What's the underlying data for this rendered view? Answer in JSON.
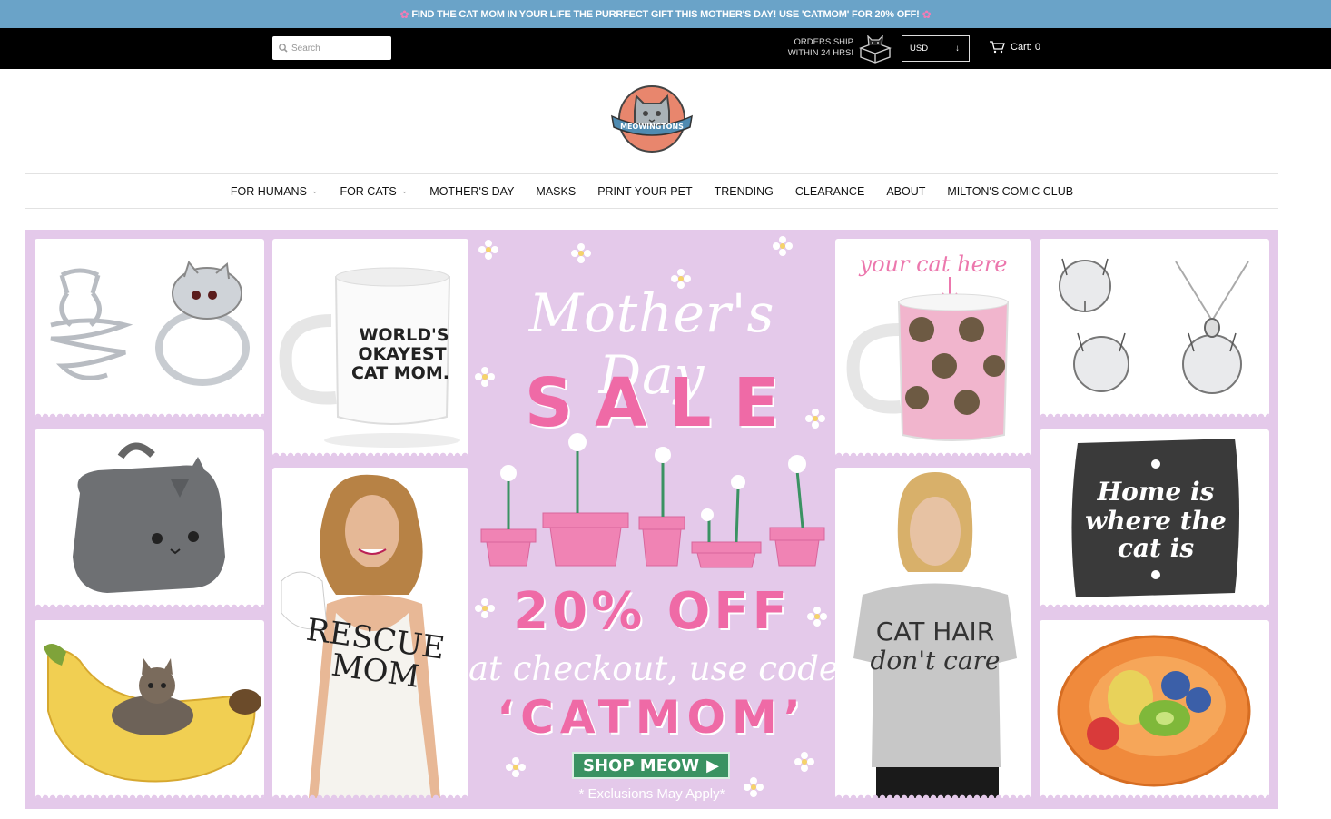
{
  "announcement": {
    "text": "FIND THE CAT MOM IN YOUR LIFE THE PURRFECT GIFT THIS MOTHER'S DAY! USE 'CATMOM' FOR 20% OFF!",
    "flower_icon": "cherry-blossom-icon"
  },
  "topbar": {
    "search_placeholder": "Search",
    "ship_line1": "ORDERS SHIP",
    "ship_line2": "WITHIN 24 HRS!",
    "currency": "USD",
    "cart_label": "Cart: 0"
  },
  "logo": {
    "text": "MEOWINGTONS"
  },
  "nav": {
    "items": [
      {
        "label": "FOR HUMANS",
        "has_dropdown": true
      },
      {
        "label": "FOR CATS",
        "has_dropdown": true
      },
      {
        "label": "MOTHER'S DAY",
        "has_dropdown": false
      },
      {
        "label": "MASKS",
        "has_dropdown": false
      },
      {
        "label": "PRINT YOUR PET",
        "has_dropdown": false
      },
      {
        "label": "TRENDING",
        "has_dropdown": false
      },
      {
        "label": "CLEARANCE",
        "has_dropdown": false
      },
      {
        "label": "ABOUT",
        "has_dropdown": false
      },
      {
        "label": "MILTON'S COMIC CLUB",
        "has_dropdown": false
      }
    ]
  },
  "banner": {
    "title_script": "Mother's Day",
    "title_sale": "SALE",
    "discount": "20% OFF",
    "checkout_line": "at checkout, use code",
    "code": "‘CATMOM’",
    "button_label": "SHOP MEOW",
    "exclusions": "* Exclusions May Apply*",
    "mug1_text": [
      "WORLD'S",
      "OKAYEST",
      "CAT MOM."
    ],
    "mug2_caption": "your cat here",
    "tank_text": [
      "RESCUE",
      "MOM"
    ],
    "tee_text": [
      "CAT HAIR",
      "don't care"
    ],
    "pillow_text": [
      "Home is",
      "where the",
      "cat is"
    ]
  },
  "colors": {
    "announcement_bg": "#6aa3c8",
    "topbar_bg": "#000000",
    "banner_bg": "#e4c9ea",
    "sale_pink": "#ef6aa6",
    "button_green": "#3a9262"
  }
}
